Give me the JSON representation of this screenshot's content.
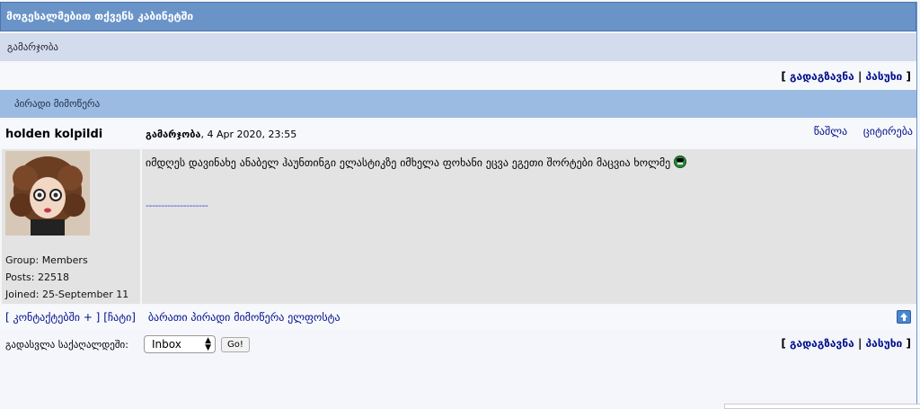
{
  "header": {
    "title": "მოგესალმებით თქვენს კაბინეტში"
  },
  "subheader": {
    "title": "გამარჯობა"
  },
  "toolbar": {
    "bracket_open": "[",
    "forward": "გადაგზავნა",
    "sep": "|",
    "reply": "პასუხი",
    "bracket_close": "]"
  },
  "pm_section": {
    "title": "პირადი მიმოწერა"
  },
  "post": {
    "author": "holden kolpildi",
    "subject": "გამარჯობა",
    "date": ", 4 Apr 2020, 23:55",
    "delete_label": "წაშლა",
    "quote_label": "ციტირება",
    "message": "იმდღეს დავინახე ანაბელ ჰაუნთინგი ელასტიკზე იმხელა ფოხანი ეცვა ეგეთი შორტები მაცვია ხოლმე",
    "signature": "--------------------",
    "group": "Group: Members",
    "posts": "Posts: 22518",
    "joined": "Joined: 25-September 11"
  },
  "footer": {
    "contacts_label": "[ კონტაქტებში + ]",
    "chat_label": "[ჩატი]",
    "all_messages_label": "ბარათი პირადი მიმოწერა ელფოსტა"
  },
  "jump": {
    "label": "გადასვლა საქაღალდეში:",
    "selected": "Inbox",
    "go_label": "Go!"
  },
  "colors": {
    "title_bar": "#6a94c8",
    "pm_bar": "#9bbbe2",
    "link": "#000f8a",
    "post_bg": "#e3e3e3"
  }
}
